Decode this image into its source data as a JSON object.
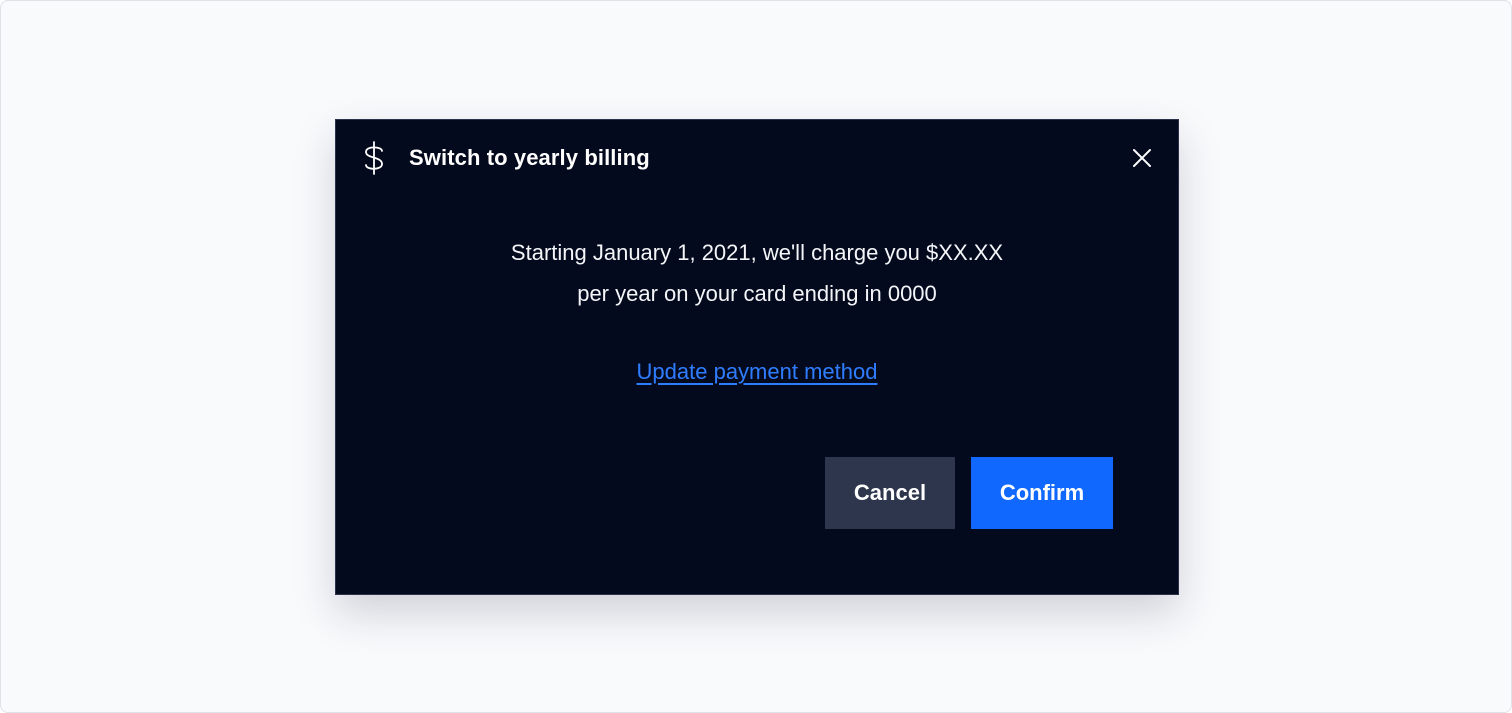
{
  "dialog": {
    "title": "Switch to yearly billing",
    "icon": "dollar-icon",
    "close_icon": "close-icon",
    "message_line1": "Starting January 1, 2021, we'll charge you $XX.XX",
    "message_line2": "per year on your card ending in 0000",
    "link_label": "Update payment method",
    "cancel_label": "Cancel",
    "confirm_label": "Confirm"
  },
  "colors": {
    "page_background": "#f9fafc",
    "dialog_background": "#040a1d",
    "link": "#2f7dff",
    "cancel_button": "#2e364e",
    "confirm_button": "#1168ff",
    "text": "#ffffff"
  }
}
